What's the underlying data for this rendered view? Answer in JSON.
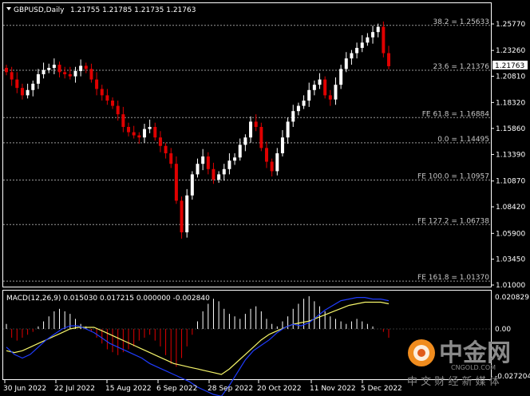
{
  "header": {
    "symbol": "GBPUSD,Daily",
    "ohlc": "1.21755 1.21785 1.21735 1.21763"
  },
  "price_axis": {
    "labels": [
      "1.25770",
      "1.23260",
      "1.20810",
      "1.18320",
      "1.15860",
      "1.13390",
      "1.10870",
      "1.08420",
      "1.05900",
      "1.03450",
      "1.01000"
    ],
    "current_price": "1.21763"
  },
  "levels": [
    {
      "label": "38.2 = 1.25633",
      "value": 1.25633
    },
    {
      "label": "23.6 = 1.21376",
      "value": 1.21376
    },
    {
      "label": "FE 61.8 = 1.16884",
      "value": 1.16884
    },
    {
      "label": "0.0 = 1.14495",
      "value": 1.14495
    },
    {
      "label": "FE 100.0 = 1.10957",
      "value": 1.10957
    },
    {
      "label": "FE 127.2 = 1.06738",
      "value": 1.06738
    },
    {
      "label": "FE 161.8 = 1.01370",
      "value": 1.0137
    }
  ],
  "macd": {
    "header": "MACD(12,26,9) 0.015030 0.017215 0.000000 -0.002840",
    "axis_labels": [
      "0.020829",
      "0.00",
      "-0.027204"
    ]
  },
  "date_axis": [
    "30 Jun 2022",
    "22 Jul 2022",
    "15 Aug 2022",
    "6 Sep 2022",
    "28 Sep 2022",
    "20 Oct 2022",
    "11 Nov 2022",
    "5 Dec 2022"
  ],
  "watermark": {
    "brand_cn": "中金网",
    "domain": "CNGOLD.COM",
    "tagline": "中 文 财 经 新 媒 体"
  },
  "colors": {
    "background": "#000000",
    "bull_candle": "#ffffff",
    "bear_candle": "#e00000",
    "level_line": "#9a9a9a",
    "macd_signal": "#f5f56a",
    "macd_main": "#1f3cff"
  },
  "chart_data": {
    "type": "candlestick",
    "price_ylim": [
      1.01,
      1.2577
    ],
    "x_dates": [
      "30 Jun 2022",
      "22 Jul 2022",
      "15 Aug 2022",
      "6 Sep 2022",
      "28 Sep 2022",
      "20 Oct 2022",
      "11 Nov 2022",
      "5 Dec 2022"
    ],
    "close_path": [
      1.212,
      1.205,
      1.197,
      1.19,
      1.195,
      1.201,
      1.21,
      1.214,
      1.216,
      1.219,
      1.212,
      1.21,
      1.208,
      1.213,
      1.218,
      1.215,
      1.205,
      1.196,
      1.19,
      1.185,
      1.18,
      1.172,
      1.16,
      1.155,
      1.152,
      1.15,
      1.158,
      1.16,
      1.15,
      1.142,
      1.135,
      1.125,
      1.09,
      1.06,
      1.095,
      1.115,
      1.125,
      1.132,
      1.12,
      1.11,
      1.115,
      1.12,
      1.128,
      1.131,
      1.143,
      1.15,
      1.165,
      1.16,
      1.14,
      1.127,
      1.118,
      1.135,
      1.15,
      1.165,
      1.175,
      1.18,
      1.185,
      1.195,
      1.2,
      1.205,
      1.19,
      1.186,
      1.2,
      1.215,
      1.225,
      1.23,
      1.235,
      1.24,
      1.245,
      1.25,
      1.255,
      1.23,
      1.2176
    ],
    "macd_ylim": [
      -0.027204,
      0.020829
    ],
    "macd_histogram": [
      0.002,
      -0.003,
      -0.004,
      -0.003,
      -0.002,
      -0.001,
      0.001,
      0.003,
      0.005,
      0.007,
      0.008,
      0.007,
      0.006,
      0.004,
      0.002,
      0.001,
      -0.001,
      -0.003,
      -0.005,
      -0.007,
      -0.008,
      -0.009,
      -0.008,
      -0.007,
      -0.006,
      -0.004,
      -0.003,
      -0.002,
      -0.004,
      -0.006,
      -0.009,
      -0.012,
      -0.013,
      -0.01,
      -0.006,
      -0.002,
      0.003,
      0.007,
      0.01,
      0.012,
      0.011,
      0.008,
      0.006,
      0.005,
      0.004,
      0.006,
      0.008,
      0.009,
      0.007,
      0.004,
      0.002,
      0.001,
      0.003,
      0.005,
      0.008,
      0.01,
      0.012,
      0.013,
      0.011,
      0.009,
      0.007,
      0.005,
      0.004,
      0.003,
      0.002,
      0.003,
      0.004,
      0.003,
      0.002,
      0.001,
      0.0,
      -0.001,
      -0.003
    ],
    "macd_signal": [
      -0.012,
      -0.013,
      -0.012,
      -0.01,
      -0.008,
      -0.006,
      -0.004,
      -0.002,
      0.0,
      0.001,
      0.001,
      0.001,
      -0.001,
      -0.003,
      -0.005,
      -0.007,
      -0.009,
      -0.011,
      -0.013,
      -0.015,
      -0.017,
      -0.019,
      -0.02,
      -0.021,
      -0.022,
      -0.023,
      -0.024,
      -0.025,
      -0.022,
      -0.018,
      -0.014,
      -0.01,
      -0.006,
      -0.003,
      -0.001,
      0.001,
      0.003,
      0.004,
      0.005,
      0.007,
      0.009,
      0.011,
      0.013,
      0.015,
      0.016,
      0.017,
      0.017,
      0.017,
      0.016
    ],
    "macd_main": [
      -0.01,
      -0.014,
      -0.016,
      -0.014,
      -0.01,
      -0.006,
      -0.003,
      0.0,
      0.002,
      0.002,
      0.0,
      -0.002,
      -0.005,
      -0.008,
      -0.01,
      -0.012,
      -0.014,
      -0.016,
      -0.019,
      -0.021,
      -0.023,
      -0.025,
      -0.027,
      -0.029,
      -0.032,
      -0.034,
      -0.036,
      -0.037,
      -0.031,
      -0.024,
      -0.017,
      -0.012,
      -0.009,
      -0.006,
      -0.002,
      0.001,
      0.003,
      0.002,
      0.004,
      0.008,
      0.012,
      0.015,
      0.018,
      0.019,
      0.02,
      0.02,
      0.019,
      0.019,
      0.018
    ]
  }
}
